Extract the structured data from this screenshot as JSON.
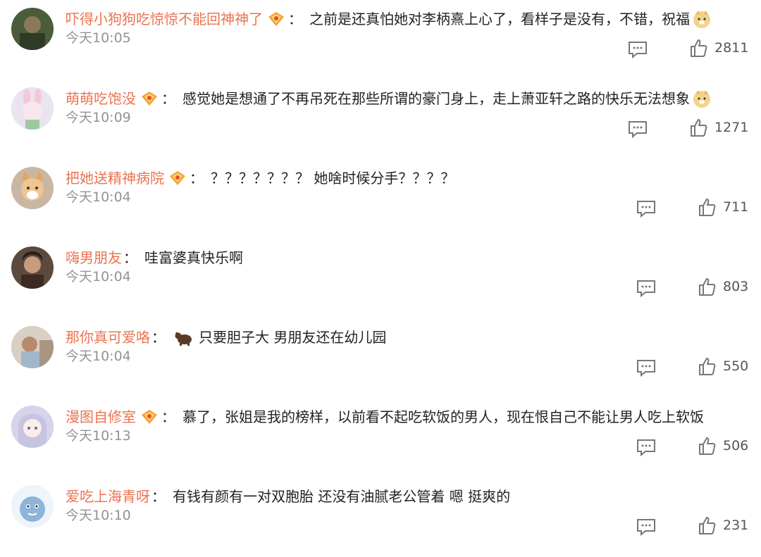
{
  "comments": [
    {
      "user": "吓得小狗狗吃惊惊不能回神神了",
      "vip": true,
      "text": "之前是还真怕她对李柄熹上心了，看样子是没有，不错，祝福",
      "emoji_after": "doge-icon",
      "time": "今天10:05",
      "likes": "2811",
      "avatar_color": "#4a5d3a"
    },
    {
      "user": "萌萌吃饱没",
      "vip": true,
      "text": "感觉她是想通了不再吊死在那些所谓的豪门身上，走上萧亚轩之路的快乐无法想象",
      "emoji_after": "doge-icon",
      "time": "今天10:09",
      "likes": "1271",
      "avatar_color": "#e9e4ef"
    },
    {
      "user": "把她送精神病院",
      "vip": true,
      "text": "？？？？？？？ 她啥时候分手？？？？",
      "emoji_after": "",
      "time": "今天10:04",
      "likes": "711",
      "avatar_color": "#d9b58a"
    },
    {
      "user": "嗨男朋友",
      "vip": false,
      "text": "哇富婆真快乐啊",
      "emoji_after": "",
      "time": "今天10:04",
      "likes": "803",
      "avatar_color": "#5c4a3e"
    },
    {
      "user": "那你真可爱咯",
      "vip": false,
      "text": "只要胆子大 男朋友还在幼儿园",
      "emoji_before": "bear-icon",
      "time": "今天10:04",
      "likes": "550",
      "avatar_color": "#b7a89a"
    },
    {
      "user": "漫图自修室",
      "vip": true,
      "text": "慕了，张姐是我的榜样，以前看不起吃软饭的男人，现在恨自己不能让男人吃上软饭",
      "emoji_after": "",
      "time": "今天10:13",
      "likes": "506",
      "avatar_color": "#d8d2ea"
    },
    {
      "user": "爱吃上海青呀",
      "vip": false,
      "text": "有钱有颜有一对双胞胎 还没有油腻老公管着 嗯 挺爽的",
      "emoji_after": "",
      "time": "今天10:10",
      "likes": "231",
      "avatar_color": "#8fb4d9"
    }
  ],
  "colors": {
    "username": "#eb7350",
    "time": "#939393",
    "text": "#222222"
  }
}
